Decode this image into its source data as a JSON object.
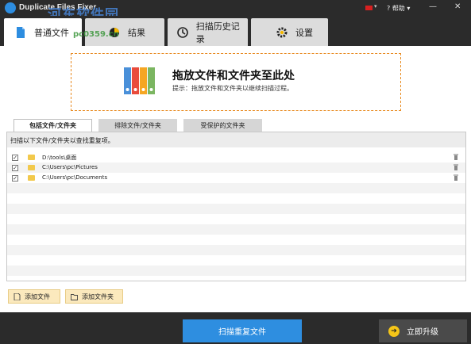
{
  "window": {
    "title": "Duplicate Files Fixer",
    "watermark": "河东软件园",
    "watermark_url": "pc0359.cn",
    "help_label": "帮助",
    "help_icon": "question-circle-icon",
    "minimize_glyph": "—",
    "close_glyph": "✕"
  },
  "tabs": [
    {
      "label": "普通文件",
      "icon": "file-icon",
      "active": true
    },
    {
      "label": "结果",
      "icon": "pie-chart-icon",
      "active": false
    },
    {
      "label": "扫描历史记录",
      "icon": "history-icon",
      "active": false
    },
    {
      "label": "设置",
      "icon": "gear-icon",
      "active": false
    }
  ],
  "dropzone": {
    "title": "拖放文件和文件夹至此处",
    "hint": "提示：拖放文件和文件夹以继续扫描过程。"
  },
  "subtabs": [
    {
      "label": "包括文件/文件夹",
      "active": true
    },
    {
      "label": "排除文件/文件夹",
      "active": false
    },
    {
      "label": "受保护的文件夹",
      "active": false
    }
  ],
  "folder_panel": {
    "header": "扫描以下文件/文件夹以查找重复项。",
    "rows": [
      {
        "checked": true,
        "path": "D:\\tools\\桌面"
      },
      {
        "checked": true,
        "path": "C:\\Users\\pc\\Pictures"
      },
      {
        "checked": true,
        "path": "C:\\Users\\pc\\Documents"
      }
    ]
  },
  "buttons": {
    "add_file": "添加文件",
    "add_folder": "添加文件夹",
    "scan": "扫描重复文件",
    "upgrade": "立即升级"
  },
  "colors": {
    "accent_blue": "#2e8ee0",
    "dark_bar": "#2b2b2b",
    "drop_border": "#e88a20",
    "add_button_bg": "#fbe9bd",
    "upgrade_icon": "#f5c518"
  }
}
